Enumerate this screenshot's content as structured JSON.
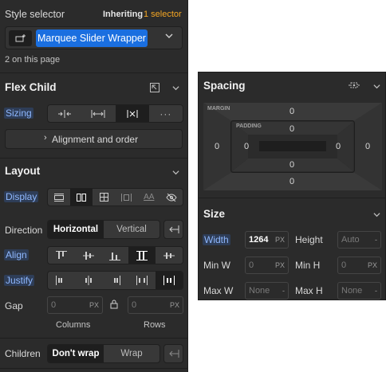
{
  "style_selector": {
    "label": "Style selector",
    "inheriting_prefix": "Inheriting",
    "inheriting_count": "1 selector",
    "chip_label": "Marquee Slider Wrapper",
    "count_text": "2 on this page"
  },
  "flex_child": {
    "title": "Flex Child",
    "sizing_label": "Sizing",
    "more": "···",
    "alignment_label": "Alignment and order"
  },
  "layout": {
    "title": "Layout",
    "display_label": "Display",
    "direction_label": "Direction",
    "direction_options": [
      "Horizontal",
      "Vertical"
    ],
    "align_label": "Align",
    "justify_label": "Justify",
    "gap_label": "Gap",
    "gap_columns_value": "0",
    "gap_rows_value": "0",
    "gap_unit": "PX",
    "columns_label": "Columns",
    "rows_label": "Rows",
    "children_label": "Children",
    "children_options": [
      "Don't wrap",
      "Wrap"
    ]
  },
  "spacing": {
    "title": "Spacing",
    "margin_label": "MARGIN",
    "padding_label": "PADDING",
    "margin": {
      "top": "0",
      "right": "0",
      "bottom": "0",
      "left": "0"
    },
    "padding": {
      "top": "0",
      "right": "0",
      "bottom": "0",
      "left": "0"
    }
  },
  "size": {
    "title": "Size",
    "width_label": "Width",
    "width_value": "1264",
    "width_unit": "PX",
    "height_label": "Height",
    "height_value": "Auto",
    "height_unit": "-",
    "min_w_label": "Min W",
    "min_w_value": "0",
    "min_w_unit": "PX",
    "min_h_label": "Min H",
    "min_h_value": "0",
    "min_h_unit": "PX",
    "max_w_label": "Max W",
    "max_w_value": "None",
    "max_w_unit": "-",
    "max_h_label": "Max H",
    "max_h_value": "None",
    "max_h_unit": "-"
  },
  "colors": {
    "panel_bg": "#2b2b2b",
    "accent_blue": "#1a6fe0",
    "orange": "#f5a623",
    "highlight_text": "#8fb8ff"
  }
}
